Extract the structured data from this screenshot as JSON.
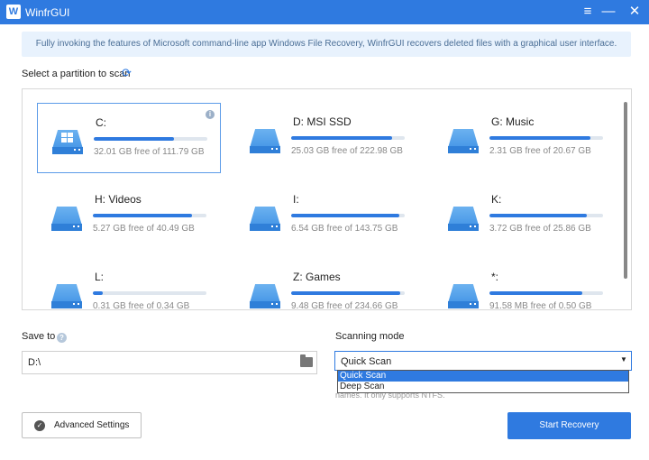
{
  "titlebar": {
    "logo_text": "W",
    "title": "WinfrGUI",
    "menu_icon": "≡",
    "minimize_icon": "—",
    "close_icon": "✕"
  },
  "banner": {
    "text": "Fully invoking the features of Microsoft command-line app Windows File Recovery, WinfrGUI recovers deleted files with a graphical user interface."
  },
  "partitions": {
    "label": "Select a partition to scan",
    "refresh_icon": "⟳",
    "info_icon": "i",
    "items": [
      {
        "name": "C:",
        "free": "32.01 GB free of 111.79 GB",
        "fill": 0.71,
        "selected": true,
        "system": true
      },
      {
        "name": "D: MSI SSD",
        "free": "25.03 GB free of 222.98 GB",
        "fill": 0.89
      },
      {
        "name": "G: Music",
        "free": "2.31 GB free of 20.67 GB",
        "fill": 0.89
      },
      {
        "name": "H: Videos",
        "free": "5.27 GB free of 40.49 GB",
        "fill": 0.87
      },
      {
        "name": "I:",
        "free": "6.54 GB free of 143.75 GB",
        "fill": 0.95
      },
      {
        "name": "K:",
        "free": "3.72 GB free of 25.86 GB",
        "fill": 0.86
      },
      {
        "name": "L:",
        "free": "0.31 GB free of 0.34 GB",
        "fill": 0.09
      },
      {
        "name": "Z: Games",
        "free": "9.48 GB free of 234.66 GB",
        "fill": 0.96
      },
      {
        "name": "*:",
        "free": "91.58 MB free of 0.50 GB",
        "fill": 0.82
      }
    ]
  },
  "save_to": {
    "label": "Save to",
    "help_icon": "?",
    "value": "D:\\"
  },
  "scanning": {
    "label": "Scanning mode",
    "selected": "Quick Scan",
    "arrow": "▼",
    "options": [
      "Quick Scan",
      "Deep Scan"
    ],
    "description": "names. It only supports NTFS."
  },
  "advanced": {
    "label": "Advanced Settings",
    "check_icon": "✓"
  },
  "start": {
    "label": "Start Recovery"
  }
}
